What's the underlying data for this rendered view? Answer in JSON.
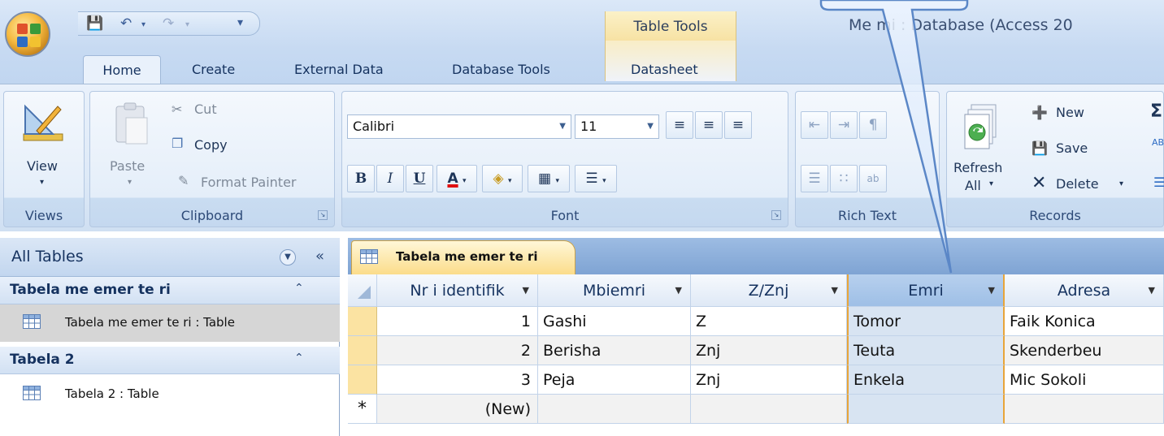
{
  "title_bar": {
    "window_title": "Me  mi : Database (Access 20",
    "context_tab_group": "Table Tools"
  },
  "ribbon_tabs": [
    "Home",
    "Create",
    "External Data",
    "Database Tools",
    "Datasheet"
  ],
  "ribbon": {
    "views": {
      "view_label": "View",
      "group_label": "Views"
    },
    "clipboard": {
      "paste_label": "Paste",
      "cut_label": "Cut",
      "copy_label": "Copy",
      "format_painter_label": "Format Painter",
      "group_label": "Clipboard"
    },
    "font": {
      "font_name": "Calibri",
      "font_size": "11",
      "bold": "B",
      "italic": "I",
      "underline": "U",
      "font_color_glyph": "A",
      "group_label": "Font"
    },
    "rich_text": {
      "group_label": "Rich Text"
    },
    "records": {
      "refresh_label": "Refresh",
      "refresh_sub": "All",
      "new_label": "New",
      "save_label": "Save",
      "delete_label": "Delete",
      "group_label": "Records"
    }
  },
  "nav_pane": {
    "title": "All Tables",
    "groups": [
      {
        "name": "Tabela me emer te ri",
        "items": [
          "Tabela me emer te ri : Table"
        ]
      },
      {
        "name": "Tabela 2",
        "items": [
          "Tabela 2 : Table"
        ]
      }
    ]
  },
  "document": {
    "tab_label": "Tabela me emer te ri",
    "columns": [
      "Nr i identifik",
      "Mbiemri",
      "Z/Znj",
      "Emri",
      "Adresa"
    ],
    "rows": [
      [
        "1",
        "Gashi",
        "Z",
        "Tomor",
        "Faik Konica"
      ],
      [
        "2",
        "Berisha",
        "Znj",
        "Teuta",
        "Skenderbeu"
      ],
      [
        "3",
        "Peja",
        "Znj",
        "Enkela",
        "Mic Sokoli"
      ]
    ],
    "new_row_marker": "*",
    "new_row_label": "(New)",
    "highlighted_column": "Emri"
  },
  "colors": {
    "ribbon_bg": "#dde9f7",
    "context_tab": "#f7e2a4",
    "selected_column_border": "#e8a53a",
    "row_selector": "#fbe3a2"
  }
}
